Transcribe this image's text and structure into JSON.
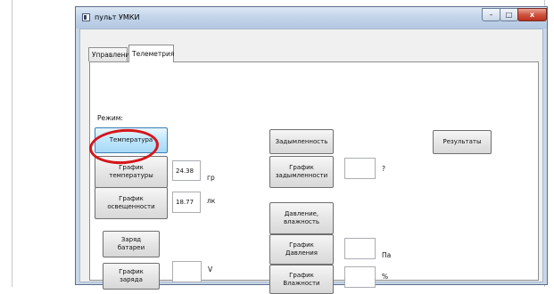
{
  "window": {
    "title": "пульт УМКИ",
    "controls": {
      "minimize": "–",
      "maximize": "□",
      "close": "x"
    }
  },
  "tabs": [
    {
      "label": "Управление",
      "selected": false
    },
    {
      "label": "Телеметрия",
      "selected": true
    }
  ],
  "telemetry": {
    "mode_label": "Режим:",
    "buttons": {
      "temperature": "Температура",
      "temp_chart": "График\nтемпературы",
      "light_chart": "График\nосвещенности",
      "battery": "Заряд\nбатареи",
      "charge_chart": "График\nзаряда",
      "smoke": "Задымленность",
      "smoke_chart": "График\nзадымленности",
      "pressure_humidity": "Давление,\nвлажность",
      "pressure_chart": "График\nДавления",
      "humidity_chart": "График\nВлажности",
      "results": "Результаты"
    },
    "fields": {
      "temperature": {
        "value": "24.38",
        "unit": "гр"
      },
      "light": {
        "value": "18.77",
        "unit": "лк"
      },
      "charge": {
        "value": "",
        "unit": "V"
      },
      "smoke": {
        "value": "",
        "unit": "?"
      },
      "pressure": {
        "value": "",
        "unit": "Па"
      },
      "humidity": {
        "value": "",
        "unit": "%"
      }
    }
  },
  "annotation": {
    "color": "#d4161a"
  }
}
